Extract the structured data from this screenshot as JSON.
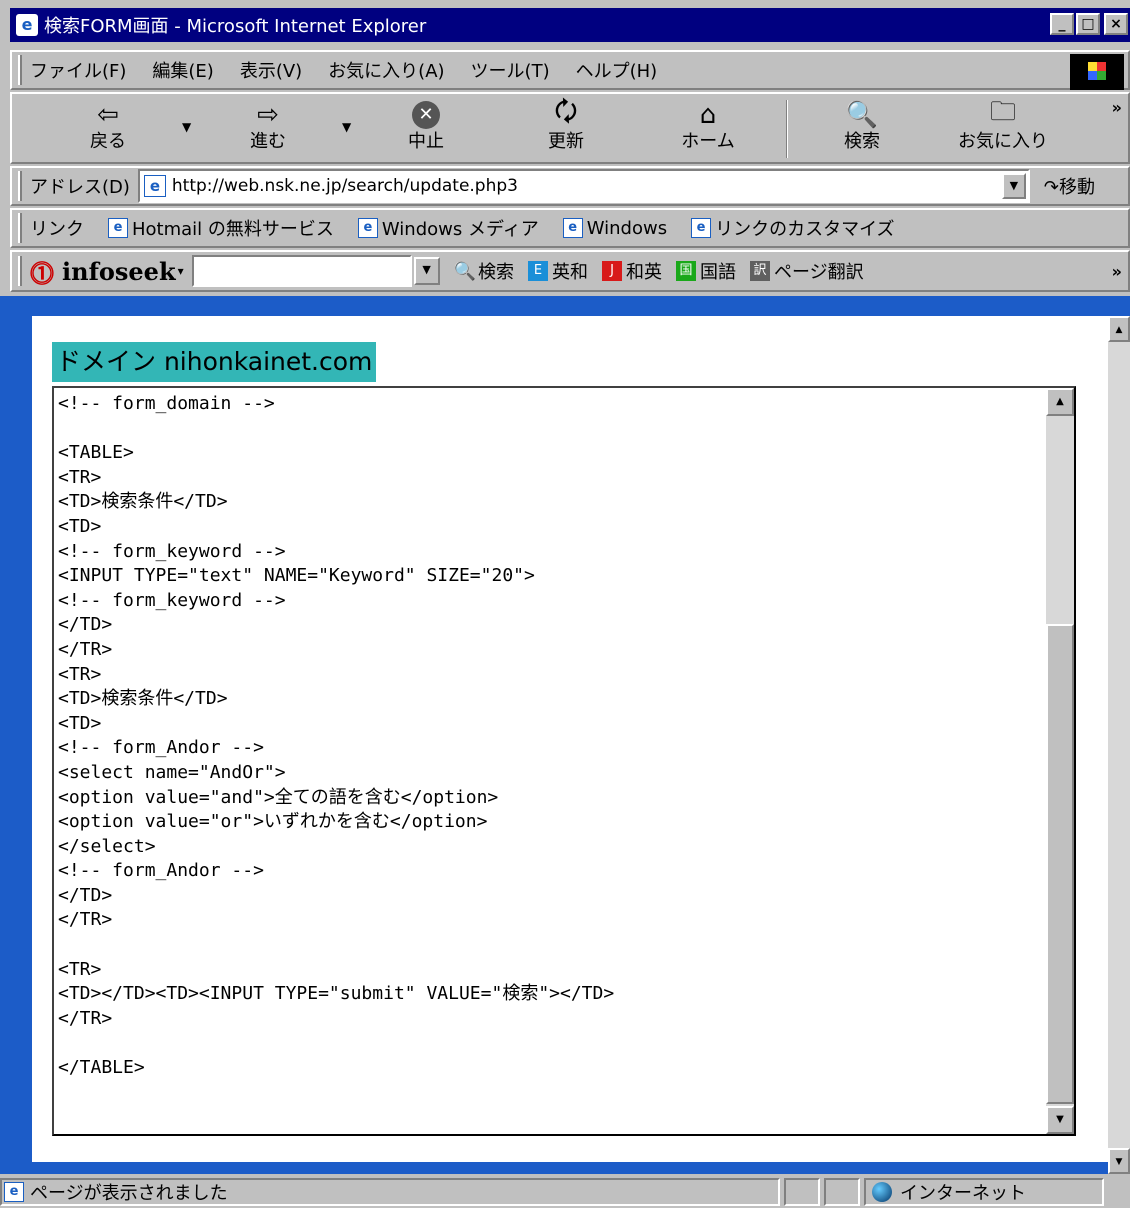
{
  "window": {
    "title": "検索FORM画面 - Microsoft Internet Explorer",
    "controls": [
      "_",
      "□",
      "×"
    ]
  },
  "menu": [
    "ファイル(F)",
    "編集(E)",
    "表示(V)",
    "お気に入り(A)",
    "ツール(T)",
    "ヘルプ(H)"
  ],
  "toolbar": {
    "back": {
      "icon": "back-arrow-icon",
      "label": "戻る"
    },
    "forward": {
      "icon": "forward-arrow-icon",
      "label": "進む"
    },
    "stop": {
      "icon": "stop-icon",
      "label": "中止"
    },
    "refresh": {
      "icon": "refresh-icon",
      "label": "更新"
    },
    "home": {
      "icon": "home-icon",
      "label": "ホーム"
    },
    "search": {
      "icon": "search-globe-icon",
      "label": "検索"
    },
    "favorites": {
      "icon": "favorites-folder-icon",
      "label": "お気に入り"
    },
    "more": "»"
  },
  "address": {
    "label": "アドレス(D)",
    "url": "http://web.nsk.ne.jp/search/update.php3",
    "go": "移動"
  },
  "links": {
    "label": "リンク",
    "items": [
      "Hotmail の無料サービス",
      "Windows メディア",
      "Windows",
      "リンクのカスタマイズ"
    ]
  },
  "infoseek": {
    "logo": "infoseek",
    "search": "検索",
    "tools": [
      {
        "label": "英和",
        "color": "#1a8fd8"
      },
      {
        "label": "和英",
        "color": "#d81a1a"
      },
      {
        "label": "国語",
        "color": "#1aa81a"
      },
      {
        "label": "ページ翻訳",
        "color": "#606060"
      }
    ],
    "more": "»"
  },
  "page": {
    "domain_label": "ドメイン nihonkainet.com",
    "code": "<!-- form_domain -->\n\n<TABLE>\n<TR>\n<TD>検索条件</TD>\n<TD>\n<!-- form_keyword -->\n<INPUT TYPE=\"text\" NAME=\"Keyword\" SIZE=\"20\">\n<!-- form_keyword -->\n</TD>\n</TR>\n<TR>\n<TD>検索条件</TD>\n<TD>\n<!-- form_Andor -->\n<select name=\"AndOr\">\n<option value=\"and\">全ての語を含む</option>\n<option value=\"or\">いずれかを含む</option>\n</select>\n<!-- form_Andor -->\n</TD>\n</TR>\n\n<TR>\n<TD></TD><TD><INPUT TYPE=\"submit\" VALUE=\"検索\"></TD>\n</TR>\n\n</TABLE>"
  },
  "status": {
    "text": "ページが表示されました",
    "zone": "インターネット"
  }
}
